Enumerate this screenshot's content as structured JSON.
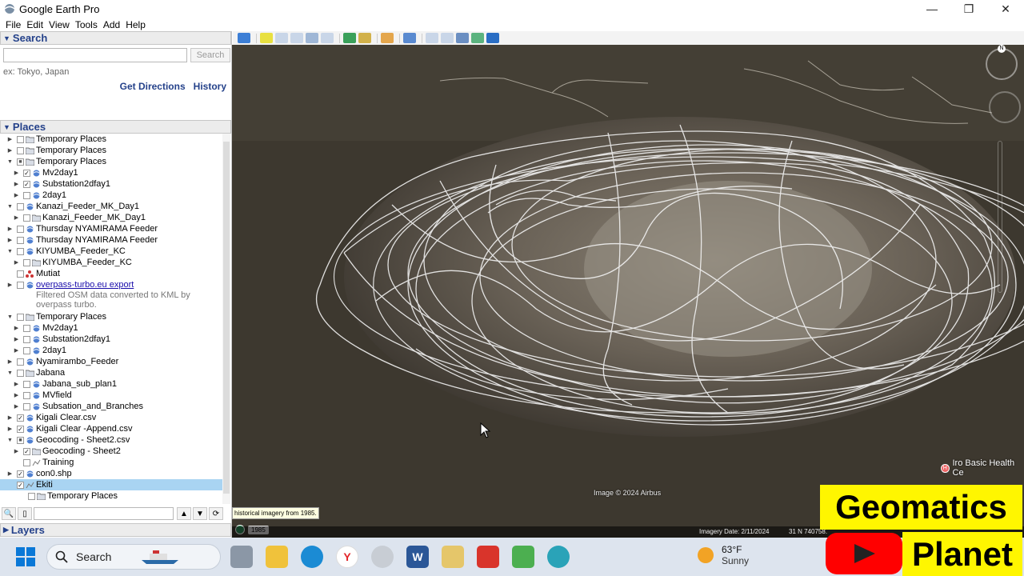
{
  "window": {
    "title": "Google Earth Pro",
    "minimize": "—",
    "maximize": "❐",
    "close": "✕"
  },
  "menu": [
    "File",
    "Edit",
    "View",
    "Tools",
    "Add",
    "Help"
  ],
  "search": {
    "header": "Search",
    "placeholder": "",
    "button": "Search",
    "hint": "ex: Tokyo, Japan",
    "get_directions": "Get Directions",
    "history": "History"
  },
  "places": {
    "header": "Places",
    "items": [
      {
        "label": "Temporary Places",
        "level": 1,
        "checked": false,
        "expanded": false,
        "icon": "folder-icon"
      },
      {
        "label": "Temporary Places",
        "level": 1,
        "checked": false,
        "expanded": false,
        "icon": "folder-icon"
      },
      {
        "label": "Temporary Places",
        "level": 1,
        "checked": "partial",
        "expanded": true,
        "icon": "folder-icon"
      },
      {
        "label": "Mv2day1",
        "level": 2,
        "checked": true,
        "expanded": false,
        "icon": "network-link-icon"
      },
      {
        "label": "Substation2dfay1",
        "level": 2,
        "checked": true,
        "expanded": false,
        "icon": "network-link-icon"
      },
      {
        "label": "2day1",
        "level": 2,
        "checked": false,
        "expanded": false,
        "icon": "network-link-icon"
      },
      {
        "label": "Kanazi_Feeder_MK_Day1",
        "level": 1,
        "checked": false,
        "expanded": true,
        "icon": "network-link-icon"
      },
      {
        "label": "Kanazi_Feeder_MK_Day1",
        "level": 2,
        "checked": false,
        "expanded": false,
        "icon": "folder-icon"
      },
      {
        "label": "Thursday NYAMIRAMA Feeder",
        "level": 1,
        "checked": false,
        "expanded": false,
        "icon": "network-link-icon"
      },
      {
        "label": "Thursday NYAMIRAMA Feeder",
        "level": 1,
        "checked": false,
        "expanded": false,
        "icon": "network-link-icon"
      },
      {
        "label": "KIYUMBA_Feeder_KC",
        "level": 1,
        "checked": false,
        "expanded": true,
        "icon": "network-link-icon"
      },
      {
        "label": "KIYUMBA_Feeder_KC",
        "level": 2,
        "checked": false,
        "expanded": false,
        "icon": "folder-icon"
      },
      {
        "label": "Mutiat",
        "level": 1,
        "checked": false,
        "expanded": false,
        "icon": "placemark-icon",
        "noexp": true
      },
      {
        "label": "overpass-turbo.eu export",
        "level": 1,
        "checked": false,
        "expanded": false,
        "icon": "network-link-icon",
        "link": true,
        "desc": "Filtered OSM data converted to KML by overpass turbo."
      },
      {
        "label": "Temporary Places",
        "level": 1,
        "checked": false,
        "expanded": true,
        "icon": "folder-icon"
      },
      {
        "label": "Mv2day1",
        "level": 2,
        "checked": false,
        "expanded": false,
        "icon": "network-link-icon"
      },
      {
        "label": "Substation2dfay1",
        "level": 2,
        "checked": false,
        "expanded": false,
        "icon": "network-link-icon"
      },
      {
        "label": "2day1",
        "level": 2,
        "checked": false,
        "expanded": false,
        "icon": "network-link-icon"
      },
      {
        "label": "Nyamirambo_Feeder",
        "level": 1,
        "checked": false,
        "expanded": false,
        "icon": "network-link-icon"
      },
      {
        "label": "Jabana",
        "level": 1,
        "checked": false,
        "expanded": true,
        "icon": "folder-icon"
      },
      {
        "label": "Jabana_sub_plan1",
        "level": 2,
        "checked": false,
        "expanded": false,
        "icon": "network-link-icon"
      },
      {
        "label": "MVfield",
        "level": 2,
        "checked": false,
        "expanded": false,
        "icon": "network-link-icon"
      },
      {
        "label": "Subsation_and_Branches",
        "level": 2,
        "checked": false,
        "expanded": false,
        "icon": "network-link-icon"
      },
      {
        "label": "Kigali Clear.csv",
        "level": 1,
        "checked": true,
        "expanded": false,
        "icon": "network-link-icon"
      },
      {
        "label": "Kigali Clear -Append.csv",
        "level": 1,
        "checked": true,
        "expanded": false,
        "icon": "network-link-icon"
      },
      {
        "label": "Geocoding - Sheet2.csv",
        "level": 1,
        "checked": "partial",
        "expanded": true,
        "icon": "network-link-icon"
      },
      {
        "label": "Geocoding - Sheet2",
        "level": 2,
        "checked": true,
        "expanded": false,
        "icon": "folder-icon"
      },
      {
        "label": "Training",
        "level": 2,
        "checked": false,
        "expanded": false,
        "icon": "path-icon",
        "noexp": true
      },
      {
        "label": "con0.shp",
        "level": 1,
        "checked": true,
        "expanded": false,
        "icon": "network-link-icon"
      },
      {
        "label": "Ekiti",
        "level": 1,
        "checked": true,
        "expanded": false,
        "icon": "path-icon",
        "noexp": true,
        "selected": true
      },
      {
        "label": "Temporary Places",
        "level": 0,
        "checked": false,
        "expanded": false,
        "icon": "folder-icon",
        "noexp": true
      }
    ]
  },
  "layers": {
    "header": "Layers"
  },
  "map": {
    "copyright": "Image © 2024 Airbus",
    "historical_tip": "historical imagery from 1985.",
    "historical_year": "1985",
    "imagery_date": "Imagery Date: 2/11/2024",
    "coordinates": "31 N 740758.",
    "poi_label": "Iro Basic Health Ce",
    "compass_north": "N"
  },
  "overlay": {
    "brand_top": "Geomatics",
    "brand_bottom": "Planet"
  },
  "taskbar": {
    "search": "Search",
    "weather_temp": "63°F",
    "weather_cond": "Sunny",
    "apps": [
      "task-view-icon",
      "file-explorer-icon",
      "edge-icon",
      "yandex-icon",
      "google-earth-icon",
      "word-icon",
      "maps-app-icon",
      "acrobat-icon",
      "photos-icon",
      "earth-search-icon"
    ]
  },
  "colors": {
    "accent": "#24418a",
    "selection": "#a9d4f2",
    "brand_yellow": "#fff600",
    "youtube_red": "#ff0000"
  }
}
